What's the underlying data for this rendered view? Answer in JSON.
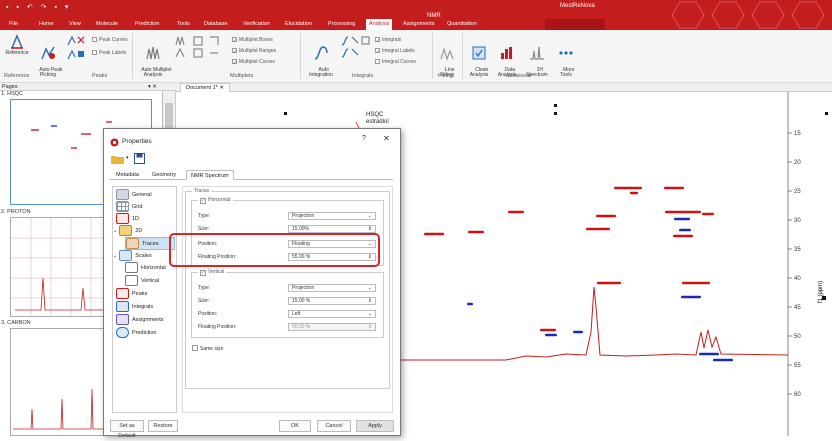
{
  "titlebar": {
    "quick_access": "▪ ▪ ↶ ↷ ▪ ▾",
    "context_title": "NMR",
    "app_title": "MestReNova"
  },
  "tabs": [
    "File",
    "Home",
    "View",
    "Molecule",
    "Prediction",
    "Tools",
    "Database",
    "Verification",
    "Elucidation",
    "Processing",
    "Analysis",
    "Assignments",
    "Quantitation"
  ],
  "active_tab": "Analysis",
  "ribbon": {
    "reference": "Reference",
    "auto_peak": "Auto Peak\nPicking",
    "peak_curves": "Peak Curves",
    "peak_labels": "Peak Labels",
    "group_reference": "Reference",
    "group_peaks": "Peaks",
    "auto_multiplet": "Auto Multiplet\nAnalysis",
    "multiplet_boxes": "Multiplet Boxes",
    "multiplet_ranges": "Multiplet Ranges",
    "multiplet_curves": "Multiplet Curves",
    "group_multiplets": "Multiplets",
    "auto_integration": "Auto\nIntegration",
    "integrals": "Integrals",
    "integral_labels": "Integral Labels",
    "integral_curves": "Integral Curves",
    "group_integrals": "Integrals",
    "line_fitting": "Line\nFitting",
    "group_fitting": "Fitting",
    "clean_analysis": "Clean\nAnalysis",
    "data_analysis": "Data\nAnalysis",
    "h1_spectrum": "1H\nSpectrum",
    "more_tools": "More\nTools",
    "group_advanced": "Advanced"
  },
  "pages": {
    "label": "Pages",
    "pin": "▾ ✕",
    "thumbs": [
      "1. HSQC",
      "2. PROTON",
      "3. CARBON"
    ]
  },
  "document": {
    "tab": "Document 1*  ✕",
    "molecule_label": "HSQC\nestradiol",
    "axis_unit": "f1 (ppm)",
    "y_ticks": [
      "15",
      "20",
      "25",
      "30",
      "35",
      "40",
      "45",
      "50",
      "55",
      "60"
    ]
  },
  "dialog": {
    "title": "Properties",
    "help": "?",
    "close": "✕",
    "tabs": [
      "Metadata",
      "Geometry",
      "NMR Spectrum"
    ],
    "active_tab": "NMR Spectrum",
    "tree": [
      "General",
      "Grid",
      "1D",
      "2D",
      "Traces",
      "Scales",
      "Horizontal",
      "Vertical",
      "Peaks",
      "Integrals",
      "Assignments",
      "Prediction"
    ],
    "selected_node": "Traces",
    "traces_legend": "Traces",
    "horizontal": {
      "legend": "Horizontal",
      "checked": true,
      "type_label": "Type:",
      "type_value": "Projection",
      "size_label": "Size:",
      "size_value": "15.00%",
      "position_label": "Position:",
      "position_value": "Floating",
      "floating_label": "Floating Position:",
      "floating_value": "55.00 %"
    },
    "vertical": {
      "legend": "Vertical",
      "checked": true,
      "type_label": "Type:",
      "type_value": "Projection",
      "size_label": "Size:",
      "size_value": "15.00 %",
      "position_label": "Position:",
      "position_value": "Left",
      "floating_label": "Floating Position:",
      "floating_value": "50.00 %"
    },
    "same_size": "Same size",
    "buttons": {
      "set_default": "Set as Default",
      "restore": "Restore",
      "ok": "OK",
      "cancel": "Cancel",
      "apply": "Apply"
    }
  },
  "colors": {
    "brand_red": "#c41d1d",
    "highlight": "#d9232d",
    "peak_red": "#d11010",
    "peak_blue": "#1a2ab8"
  }
}
